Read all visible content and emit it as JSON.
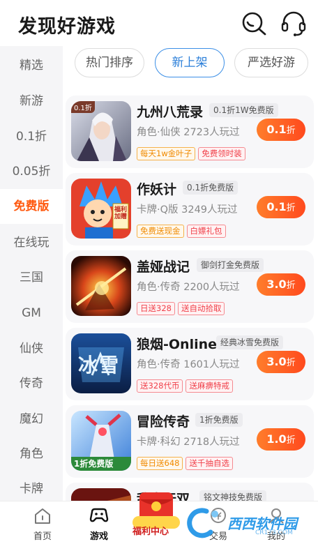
{
  "header": {
    "title": "发现好游戏",
    "icons": [
      "search-icon",
      "headset-icon"
    ]
  },
  "sidebar": {
    "items": [
      {
        "label": "精选"
      },
      {
        "label": "新游"
      },
      {
        "label": "0.1折"
      },
      {
        "label": "0.05折"
      },
      {
        "label": "免费版",
        "active": true
      },
      {
        "label": "在线玩"
      },
      {
        "label": "三国"
      },
      {
        "label": "GM"
      },
      {
        "label": "仙侠"
      },
      {
        "label": "传奇"
      },
      {
        "label": "魔幻"
      },
      {
        "label": "角色"
      },
      {
        "label": "卡牌"
      }
    ]
  },
  "tabs": [
    {
      "label": "热门排序"
    },
    {
      "label": "新上架",
      "active": true
    },
    {
      "label": "严选好游"
    }
  ],
  "games": [
    {
      "name": "九州八荒录",
      "tag": "0.1折1W免费版",
      "meta": "角色·仙侠  2723人玩过",
      "badges": [
        {
          "text": "每天1w金叶子",
          "color": "orange"
        },
        {
          "text": "免费领时装",
          "color": "red"
        }
      ],
      "discount": "0.1",
      "discount_unit": "折",
      "thumb_label": "0.1折"
    },
    {
      "name": "作妖计",
      "tag": "0.1折免费版",
      "meta": "卡牌·Q版  3249人玩过",
      "badges": [
        {
          "text": "免费送现金",
          "color": "orange"
        },
        {
          "text": "白嫖礼包",
          "color": "red"
        }
      ],
      "discount": "0.1",
      "discount_unit": "折",
      "thumb_label": "福利加赠"
    },
    {
      "name": "盖娅战记",
      "tag": "御剑打金免费版",
      "meta": "角色·传奇  2200人玩过",
      "badges": [
        {
          "text": "日送328",
          "color": "red"
        },
        {
          "text": "送自动拾取",
          "color": "red"
        }
      ],
      "discount": "3.0",
      "discount_unit": "折",
      "thumb_label": ""
    },
    {
      "name": "狼烟-Online",
      "tag": "经典冰雪免费版",
      "meta": "角色·传奇  1601人玩过",
      "badges": [
        {
          "text": "送328代币",
          "color": "red"
        },
        {
          "text": "送麻痹特戒",
          "color": "red"
        }
      ],
      "discount": "3.0",
      "discount_unit": "折",
      "thumb_label": "冰雪"
    },
    {
      "name": "冒险传奇",
      "tag": "1折免费版",
      "meta": "卡牌·科幻  2718人玩过",
      "badges": [
        {
          "text": "每日送648",
          "color": "orange"
        },
        {
          "text": "送千抽自选",
          "color": "red"
        }
      ],
      "discount": "1.0",
      "discount_unit": "折",
      "thumb_label": "1折免费版"
    },
    {
      "name": "乱世无双",
      "tag": "铭文神技免费版",
      "meta": "",
      "badges": [],
      "discount": "",
      "discount_unit": "",
      "thumb_label": ""
    }
  ],
  "bottom_nav": {
    "items": [
      {
        "label": "首页"
      },
      {
        "label": "游戏",
        "active": true
      },
      {
        "label": "交易"
      },
      {
        "label": "我的"
      }
    ],
    "welfare": "福利中心"
  },
  "watermark": {
    "text": "西西软件园",
    "sub": "CR173.COM"
  },
  "colors": {
    "accent": "#ff5a10",
    "tab_active": "#2b7fd9",
    "discount_gradient": [
      "#ff7d2b",
      "#ff4a1e"
    ]
  }
}
